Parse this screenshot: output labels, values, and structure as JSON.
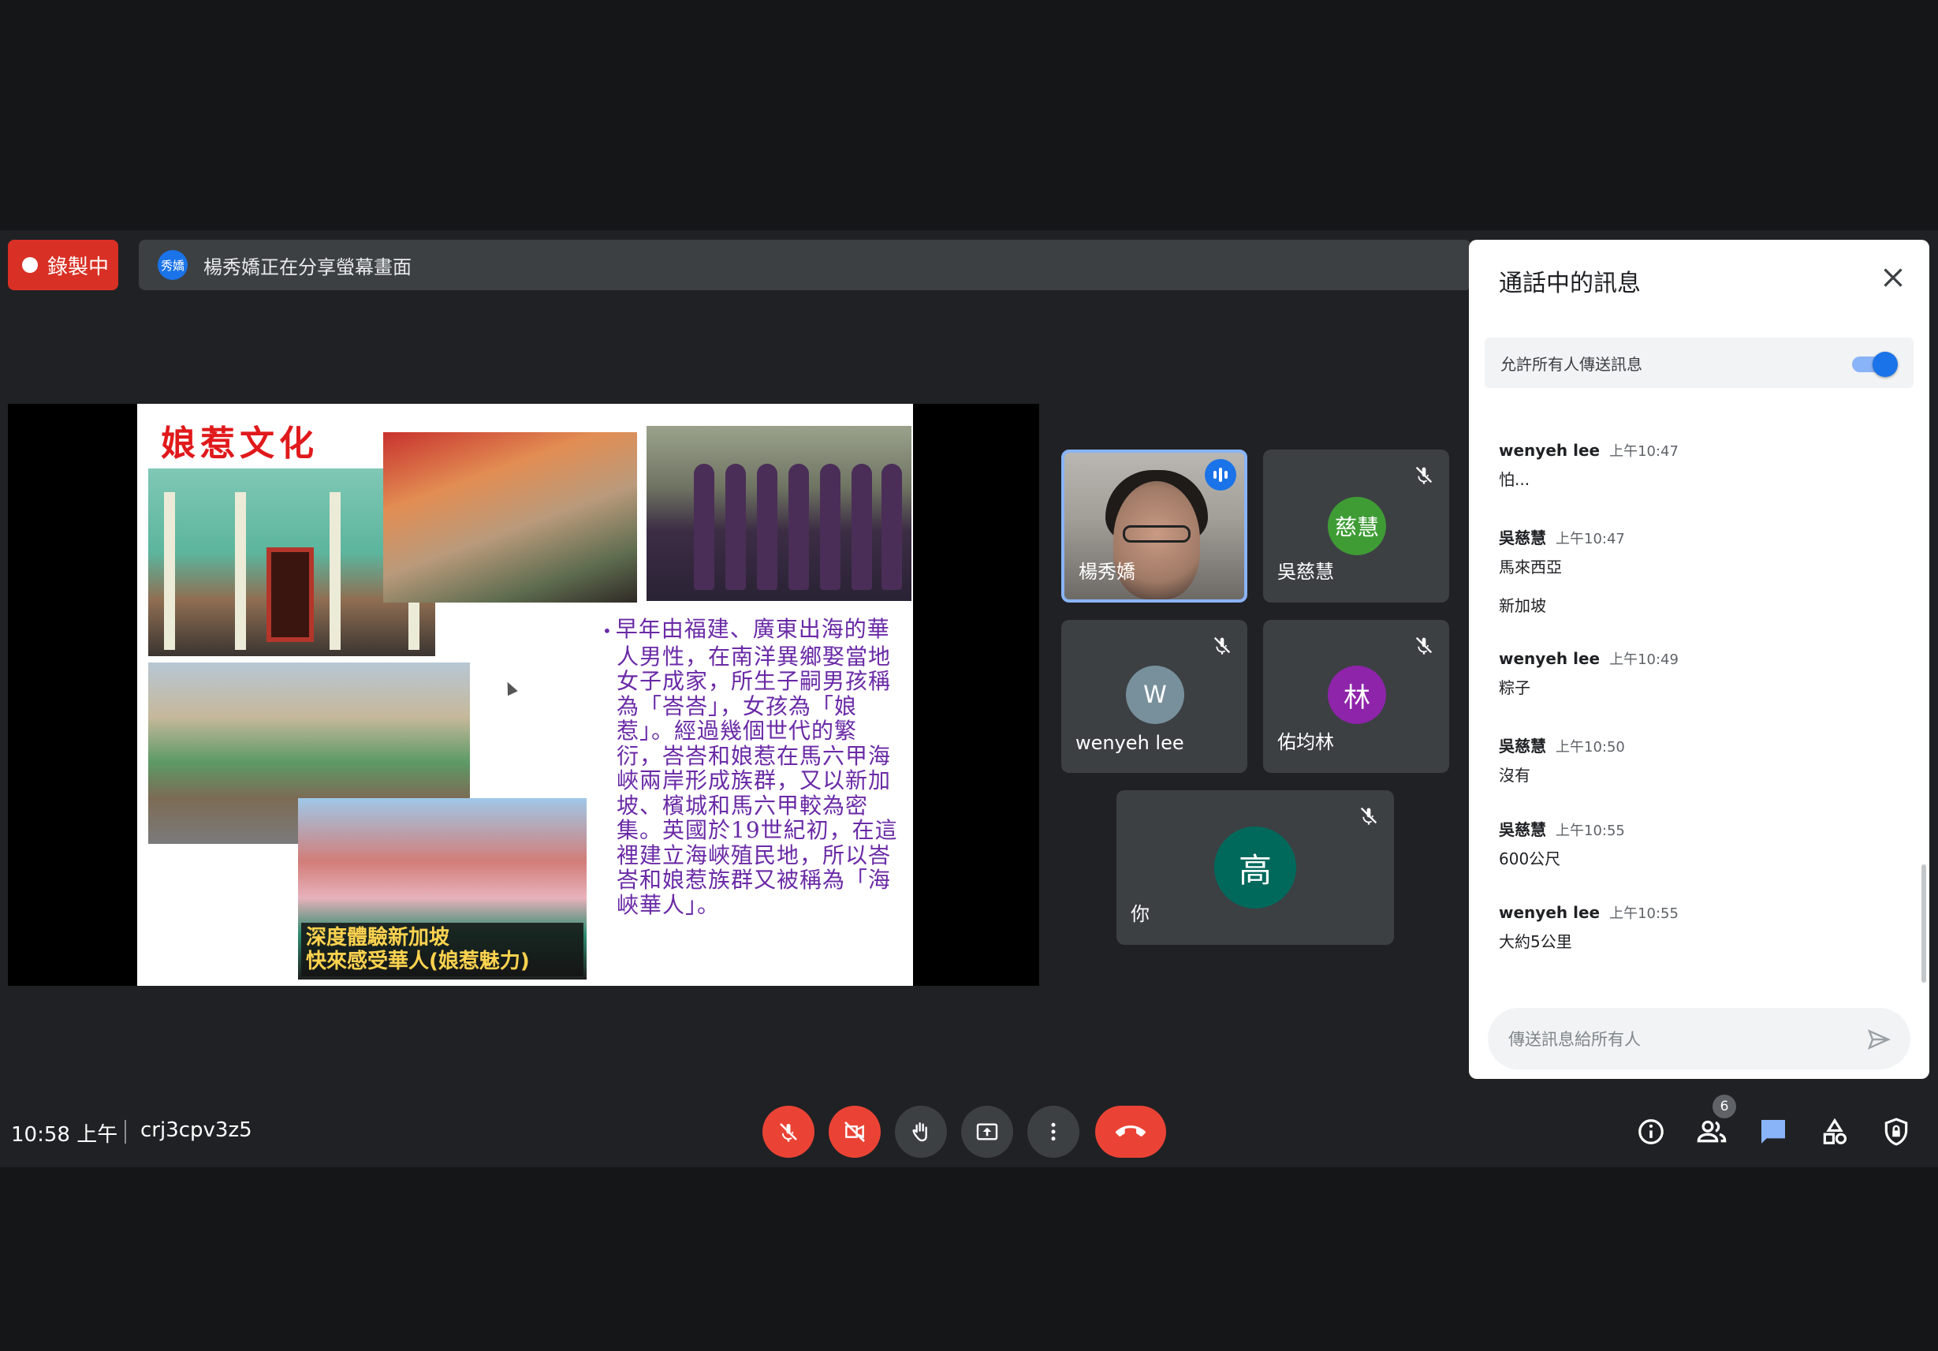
{
  "top_bar": {
    "recording_label": "錄製中",
    "presenter_avatar_text": "秀嬌",
    "sharing_text": "楊秀嬌正在分享螢幕畫面"
  },
  "slide": {
    "title": "娘惹文化",
    "banner_line1": "深度體驗新加坡",
    "banner_line2": "快來感受華人(娘惹魅力)",
    "body": "早年由福建、廣東出海的華人男性，在南洋異鄉娶當地女子成家，所生子嗣男孩稱為「峇峇」，女孩為「娘惹」。經過幾個世代的繁衍，峇峇和娘惹在馬六甲海峽兩岸形成族群，又以新加坡、檳城和馬六甲較為密集。英國於19世紀初，在這裡建立海峽殖民地，所以峇峇和娘惹族群又被稱為「海峽華人」。"
  },
  "participants": [
    {
      "name": "楊秀嬌",
      "avatar": "",
      "speaking": true
    },
    {
      "name": "吳慈慧",
      "avatar": "慈慧",
      "color": "#3f9c35",
      "muted": true
    },
    {
      "name": "wenyeh lee",
      "avatar": "W",
      "color": "#78909c",
      "muted": true
    },
    {
      "name": "佑均林",
      "avatar": "林",
      "color": "#8e24aa",
      "muted": true
    },
    {
      "name": "你",
      "avatar": "高",
      "color": "#00695c",
      "muted": true
    }
  ],
  "chat": {
    "title": "通話中的訊息",
    "allow_label": "允許所有人傳送訊息",
    "input_placeholder": "傳送訊息給所有人",
    "messages": [
      {
        "sender": "wenyeh lee",
        "time": "上午10:47",
        "text": "怕...",
        "text2": ""
      },
      {
        "sender": "吳慈慧",
        "time": "上午10:47",
        "text": "馬來西亞",
        "text2": "新加坡"
      },
      {
        "sender": "wenyeh lee",
        "time": "上午10:49",
        "text": "粽子",
        "text2": ""
      },
      {
        "sender": "吳慈慧",
        "time": "上午10:50",
        "text": "沒有",
        "text2": ""
      },
      {
        "sender": "吳慈慧",
        "time": "上午10:55",
        "text": "600公尺",
        "text2": ""
      },
      {
        "sender": "wenyeh lee",
        "time": "上午10:55",
        "text": "大約5公里",
        "text2": ""
      }
    ]
  },
  "bottom_bar": {
    "time": "10:58 上午",
    "meeting_code": "crj3cpv3z5",
    "people_count": "6"
  },
  "colors": {
    "background": "#202124",
    "danger": "#ea4335",
    "accent": "#1a73e8"
  }
}
